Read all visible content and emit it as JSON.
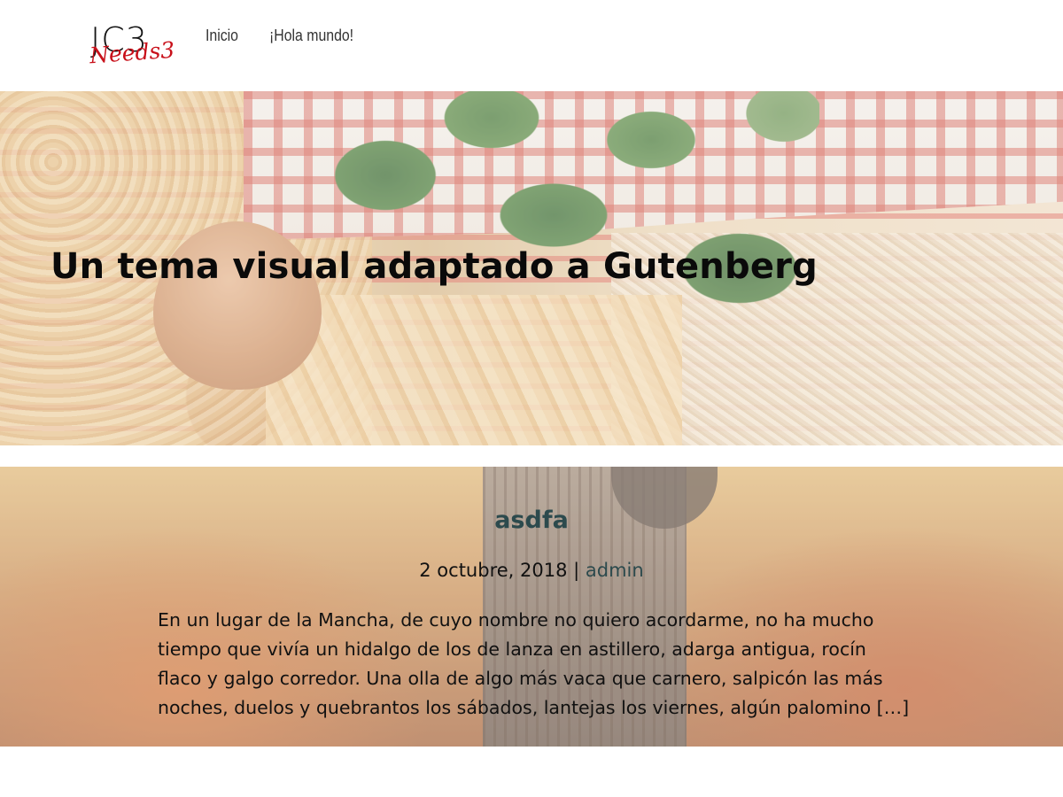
{
  "header": {
    "logo": {
      "main_text": "JC3",
      "script_text": "Needs3"
    },
    "nav": [
      {
        "label": "Inicio"
      },
      {
        "label": "¡Hola mundo!"
      }
    ]
  },
  "hero": {
    "title": "Un tema visual adaptado a Gutenberg"
  },
  "post": {
    "title": "asdfa",
    "date": "2 octubre, 2018",
    "separator": " | ",
    "author": "admin",
    "excerpt": "En un lugar de la Mancha, de cuyo nombre no quiero acordarme, no ha mucho tiempo que vivía un hidalgo de los de lanza en astillero, adarga antigua, rocín flaco y galgo corredor. Una olla de algo más vaca que carnero, salpicón las más noches, duelos y quebrantos los sábados, lantejas los viernes, algún palomino […]"
  },
  "colors": {
    "post_title": "#2c4a4d",
    "logo_script": "#c8101a",
    "nav_text": "#333333"
  }
}
